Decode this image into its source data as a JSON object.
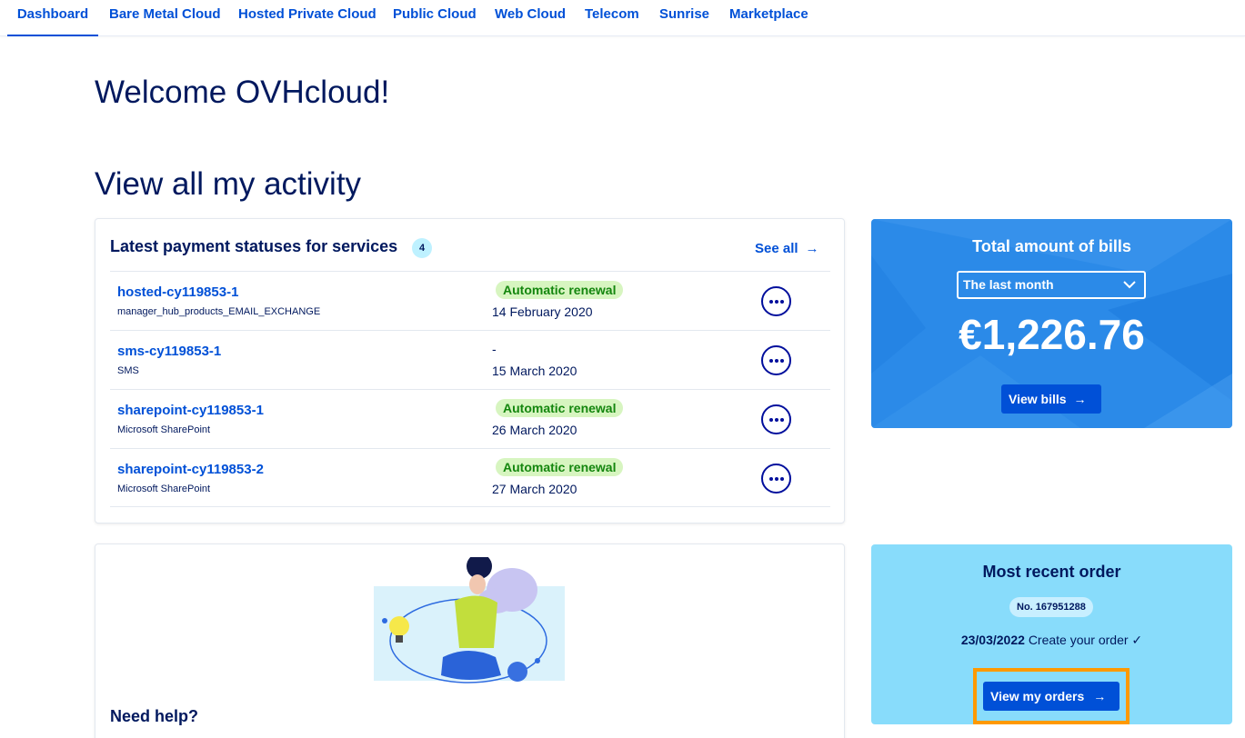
{
  "nav": {
    "tabs": [
      "Dashboard",
      "Bare Metal Cloud",
      "Hosted Private Cloud",
      "Public Cloud",
      "Web Cloud",
      "Telecom",
      "Sunrise",
      "Marketplace"
    ],
    "active": "Dashboard"
  },
  "welcome": "Welcome OVHcloud!",
  "activity_heading": "View all my activity",
  "payments": {
    "title": "Latest payment statuses for services",
    "count": "4",
    "see_all": "See all",
    "rows": [
      {
        "name": "hosted-cy119853-1",
        "type": "manager_hub_products_EMAIL_EXCHANGE",
        "status": "Automatic renewal",
        "date": "14 February 2020"
      },
      {
        "name": "sms-cy119853-1",
        "type": "SMS",
        "status": "-",
        "date": "15 March 2020"
      },
      {
        "name": "sharepoint-cy119853-1",
        "type": "Microsoft SharePoint",
        "status": "Automatic renewal",
        "date": "26 March 2020"
      },
      {
        "name": "sharepoint-cy119853-2",
        "type": "Microsoft SharePoint",
        "status": "Automatic renewal",
        "date": "27 March 2020"
      }
    ]
  },
  "bills": {
    "title": "Total amount of bills",
    "period": "The last month",
    "amount": "€1,226.76",
    "button": "View bills"
  },
  "help": {
    "title": "Need help?"
  },
  "order": {
    "title": "Most recent order",
    "number": "No. 167951288",
    "date": "23/03/2022",
    "status": "Create your order",
    "button": "View my orders"
  },
  "colors": {
    "primary": "#0050d7",
    "heading": "#00185e",
    "bills_bg": "#2b8ae8",
    "order_bg": "#88dcfb",
    "renewal_bg": "#d7f5c0",
    "renewal_text": "#14860e",
    "highlight": "#ff9900"
  },
  "icons": [
    "arrow-right-icon",
    "chevron-down-icon",
    "more-options-icon",
    "checkmark-icon"
  ]
}
